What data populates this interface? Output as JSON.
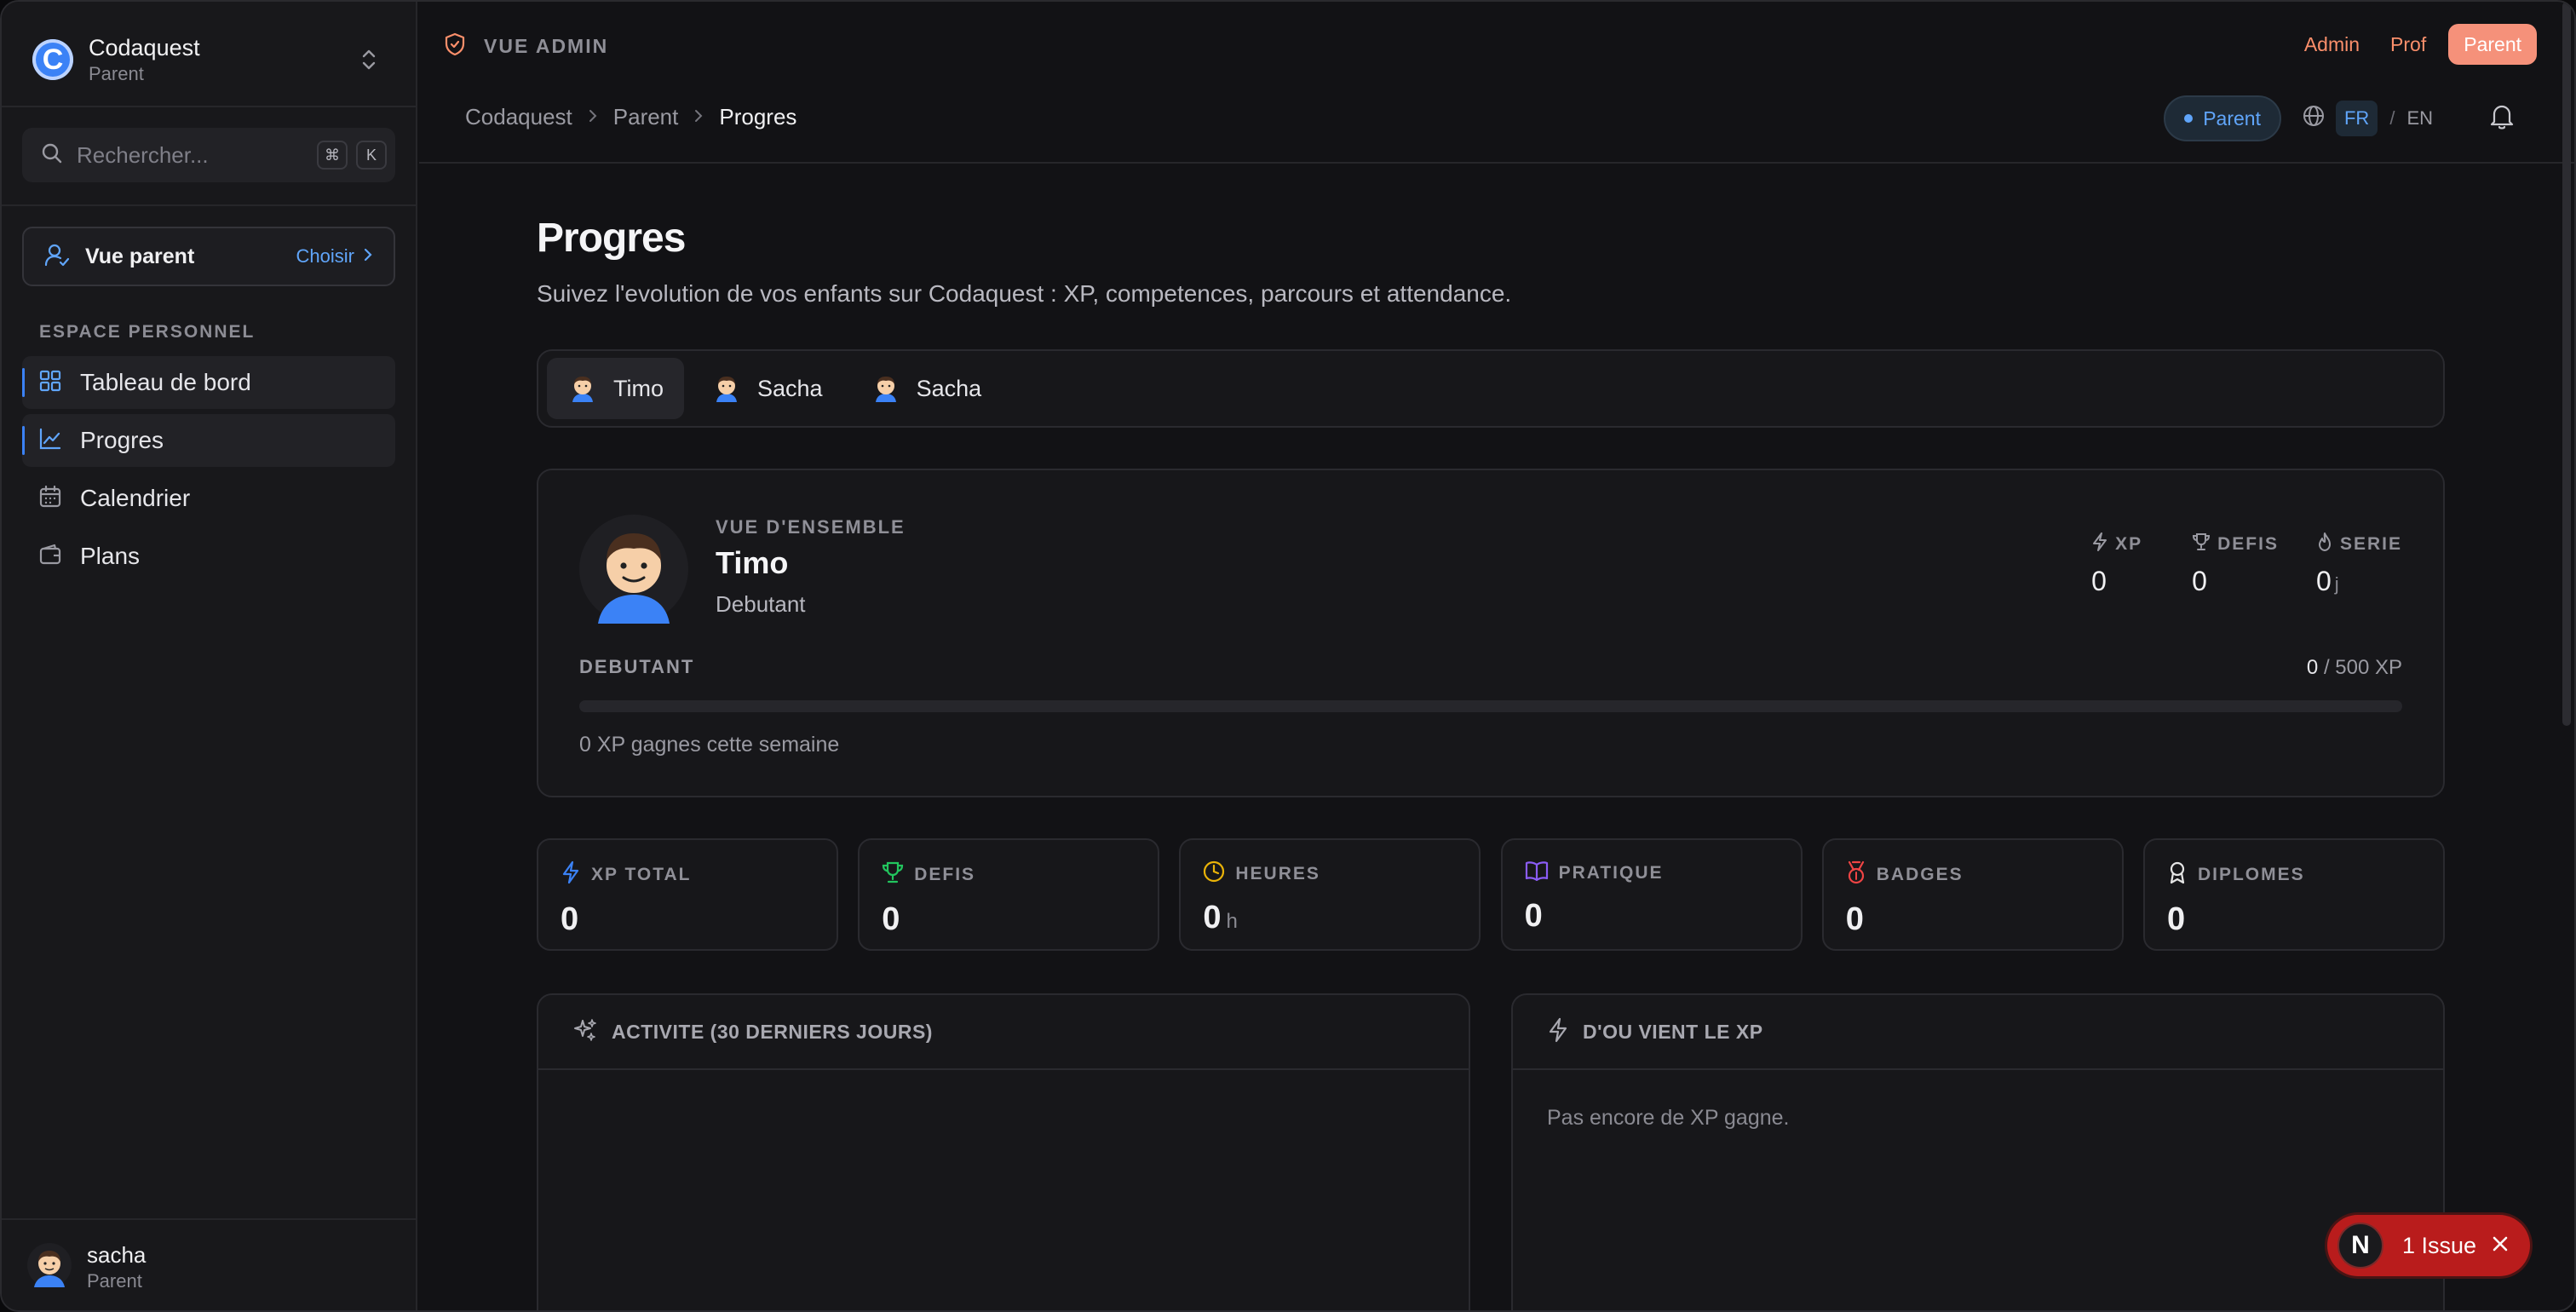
{
  "sidebar": {
    "brand_initial": "C",
    "brand_name": "Codaquest",
    "brand_sub": "Parent",
    "search_placeholder": "Rechercher...",
    "kbd1": "⌘",
    "kbd2": "K",
    "parent_label": "Vue parent",
    "parent_choose": "Choisir",
    "section_title": "ESPACE PERSONNEL",
    "items": [
      {
        "label": "Tableau de bord",
        "icon": "dashboard-icon"
      },
      {
        "label": "Progres",
        "icon": "chart-line-icon"
      },
      {
        "label": "Calendrier",
        "icon": "calendar-icon"
      },
      {
        "label": "Plans",
        "icon": "wallet-icon"
      }
    ],
    "user_name": "sacha",
    "user_role": "Parent"
  },
  "topbar": {
    "admin_label": "VUE ADMIN",
    "roles": [
      "Admin",
      "Prof",
      "Parent"
    ],
    "breadcrumb": [
      "Codaquest",
      "Parent",
      "Progres"
    ],
    "role_pill": "Parent",
    "lang_fr": "FR",
    "lang_sep": "/",
    "lang_en": "EN"
  },
  "main": {
    "title": "Progres",
    "subtitle": "Suivez l'evolution de vos enfants sur Codaquest : XP, competences, parcours et attendance.",
    "tabs": [
      "Timo",
      "Sacha",
      "Sacha"
    ],
    "overview": {
      "kicker": "VUE D'ENSEMBLE",
      "name": "Timo",
      "level": "Debutant",
      "stats": [
        {
          "label": "XP",
          "value": "0",
          "unit": ""
        },
        {
          "label": "DEFIS",
          "value": "0",
          "unit": ""
        },
        {
          "label": "SERIE",
          "value": "0",
          "unit": "j"
        }
      ],
      "progress_label": "DEBUTANT",
      "progress_current": "0",
      "progress_total": "/ 500 XP",
      "progress_fraction": 0,
      "week_text": "0 XP gagnes cette semaine"
    },
    "stat_cards": [
      {
        "label": "XP TOTAL",
        "value": "0",
        "unit": "",
        "color": "#3b82f6"
      },
      {
        "label": "DEFIS",
        "value": "0",
        "unit": "",
        "color": "#22c55e"
      },
      {
        "label": "HEURES",
        "value": "0",
        "unit": "h",
        "color": "#eab308"
      },
      {
        "label": "PRATIQUE",
        "value": "0",
        "unit": "",
        "color": "#8b5cf6"
      },
      {
        "label": "BADGES",
        "value": "0",
        "unit": "",
        "color": "#ef4444"
      },
      {
        "label": "DIPLOMES",
        "value": "0",
        "unit": "",
        "color": "#e5e5e5"
      }
    ],
    "activity_title": "ACTIVITE (30 DERNIERS JOURS)",
    "xp_source_title": "D'OU VIENT LE XP",
    "xp_source_empty": "Pas encore de XP gagne."
  },
  "issue": {
    "initial": "N",
    "label": "1 Issue"
  }
}
